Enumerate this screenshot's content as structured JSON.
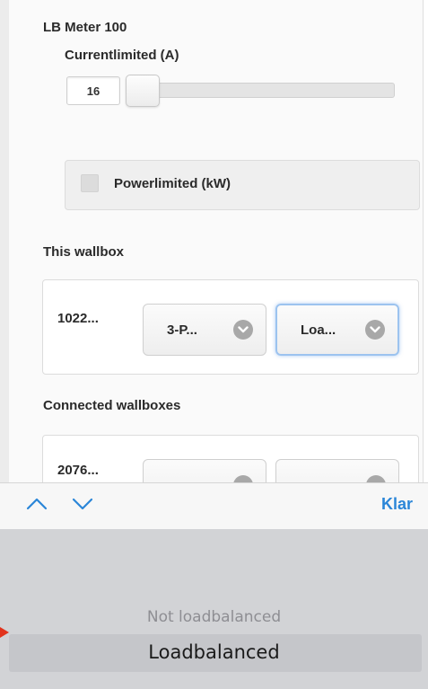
{
  "meter": {
    "title": "LB Meter 100",
    "current_label": "Currentlimited (A)",
    "current_value": "16",
    "slider_fraction": 0.06,
    "power_label": "Powerlimited (kW)",
    "power_checked": false
  },
  "this_wallbox": {
    "heading": "This wallbox",
    "id": "1022...",
    "phase_select": "3-P...",
    "mode_select": "Loa..."
  },
  "connected_wallboxes": {
    "heading": "Connected wallboxes",
    "items": [
      {
        "id": "2076..."
      }
    ]
  },
  "toolbar": {
    "prev_icon": "chevron-up-icon",
    "next_icon": "chevron-down-icon",
    "done_label": "Klar",
    "accent_color": "#2b86d8"
  },
  "picker": {
    "options": [
      "Not loadbalanced",
      "Loadbalanced"
    ],
    "selected": "Loadbalanced"
  },
  "annotation": {
    "arrow_color": "#e2331d"
  }
}
